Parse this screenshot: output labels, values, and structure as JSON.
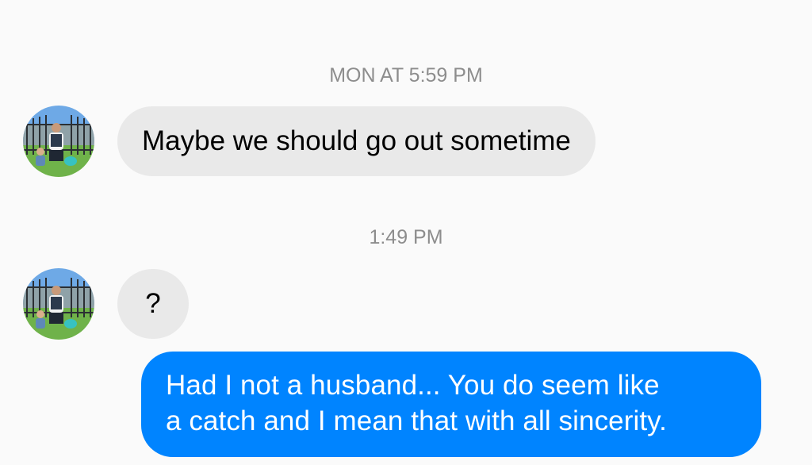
{
  "conversation": {
    "messages": [
      {
        "timestamp": "MON AT 5:59 PM",
        "sender": "other",
        "text": "Maybe we should go out sometime"
      },
      {
        "timestamp": "1:49 PM",
        "sender": "other",
        "text": "?"
      },
      {
        "sender": "me",
        "lines": [
          "Had I not a husband... You do seem like",
          "a catch and I mean that with all sincerity."
        ]
      }
    ]
  },
  "colors": {
    "background": "#fafafa",
    "incoming_bubble": "#e9e9e9",
    "outgoing_bubble": "#0084ff",
    "timestamp_text": "#8d8d8d"
  },
  "icons": {
    "avatar": "contact-photo-avatar-icon"
  }
}
